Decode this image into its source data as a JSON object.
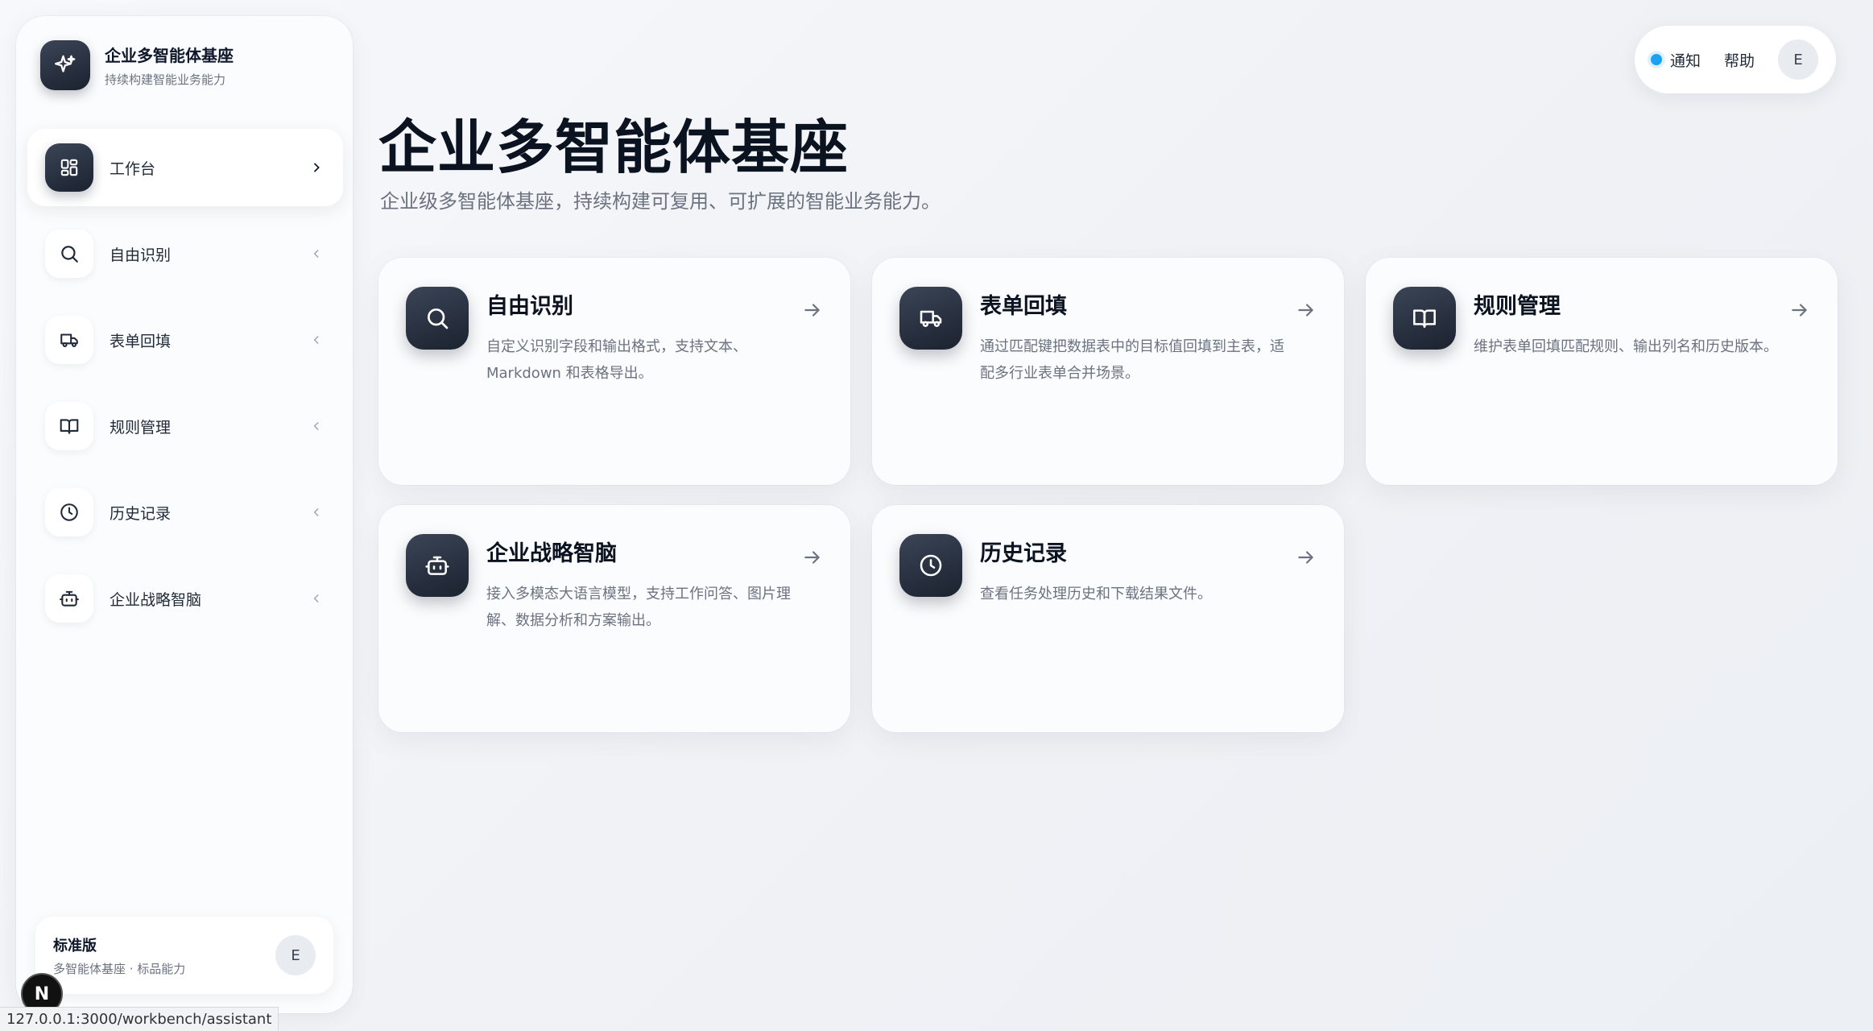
{
  "brand": {
    "title": "企业多智能体基座",
    "subtitle": "持续构建智能业务能力",
    "icon": "sparkle-icon"
  },
  "nav": {
    "items": [
      {
        "label": "工作台",
        "icon": "grid-icon",
        "active": true
      },
      {
        "label": "自由识别",
        "icon": "search-icon"
      },
      {
        "label": "表单回填",
        "icon": "truck-icon"
      },
      {
        "label": "规则管理",
        "icon": "book-icon"
      },
      {
        "label": "历史记录",
        "icon": "clock-icon"
      },
      {
        "label": "企业战略智脑",
        "icon": "bot-icon"
      }
    ]
  },
  "plan": {
    "title": "标准版",
    "subtitle": "多智能体基座 · 标品能力",
    "avatar": "E"
  },
  "topbar": {
    "notify": "通知",
    "help": "帮助",
    "avatar": "E"
  },
  "main": {
    "title": "企业多智能体基座",
    "subtitle": "企业级多智能体基座，持续构建可复用、可扩展的智能业务能力。",
    "cards": [
      {
        "title": "自由识别",
        "desc": "自定义识别字段和输出格式，支持文本、Markdown 和表格导出。",
        "icon": "search-icon"
      },
      {
        "title": "表单回填",
        "desc": "通过匹配键把数据表中的目标值回填到主表，适配多行业表单合并场景。",
        "icon": "truck-icon"
      },
      {
        "title": "规则管理",
        "desc": "维护表单回填匹配规则、输出列名和历史版本。",
        "icon": "book-icon"
      },
      {
        "title": "企业战略智脑",
        "desc": "接入多模态大语言模型，支持工作问答、图片理解、数据分析和方案输出。",
        "icon": "bot-icon"
      },
      {
        "title": "历史记录",
        "desc": "查看任务处理历史和下载结果文件。",
        "icon": "clock-icon"
      }
    ]
  },
  "status_bar": {
    "url": "127.0.0.1:3000/workbench/assistant",
    "badge": "N"
  },
  "colors": {
    "accent": "#1da1f2",
    "icon_bg": "#1b2230"
  }
}
